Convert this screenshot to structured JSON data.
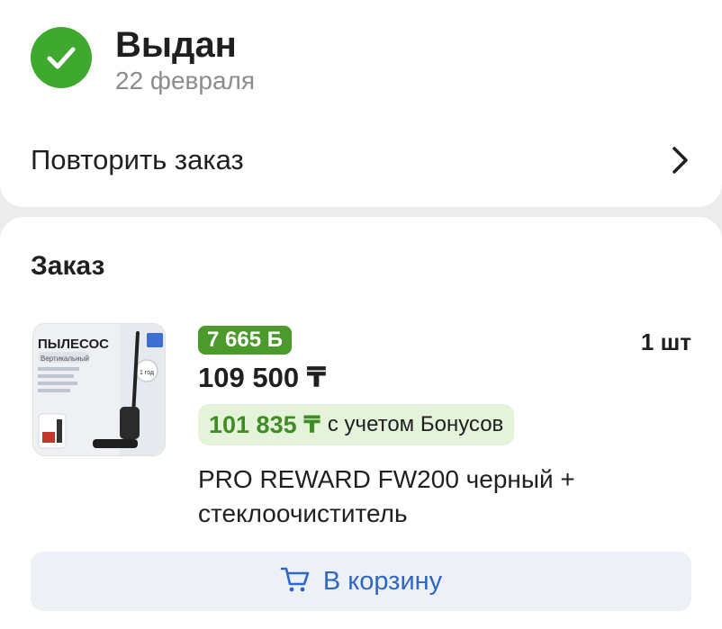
{
  "status": {
    "title": "Выдан",
    "date": "22 февраля",
    "icon": "check-circle-icon",
    "color": "#3ea82f"
  },
  "repeat": {
    "label": "Повторить заказ",
    "icon": "chevron-right-icon"
  },
  "order": {
    "title": "Заказ",
    "item": {
      "image": {
        "title": "ПЫЛЕСОС",
        "subtitle": "Вертикальный",
        "badge": "1 год"
      },
      "bonus": "7 665 Б",
      "price": "109 500 ₸",
      "bonus_price": "101 835 ₸",
      "bonus_note": "с учетом Бонусов",
      "quantity": "1 шт",
      "name": "PRO REWARD FW200 черный + стеклоочиститель"
    },
    "cart_button": {
      "label": "В корзину",
      "icon": "cart-icon"
    }
  }
}
